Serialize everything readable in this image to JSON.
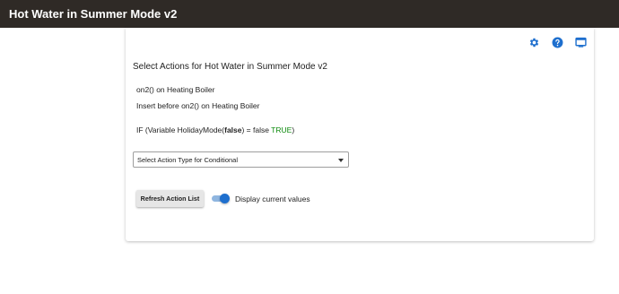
{
  "app": {
    "title": "Hot Water in Summer Mode v2",
    "accent": "#1e6fce",
    "header_bg": "#2f2a26"
  },
  "card": {
    "heading": "Select Actions for Hot Water in Summer Mode v2",
    "actions": {
      "line1": "on2() on Heating Boiler",
      "line2": "Insert before on2() on Heating Boiler",
      "condition": {
        "prefix": "IF (Variable HolidayMode(",
        "value": "false",
        "middle": ") = false ",
        "result": "TRUE",
        "suffix": ")"
      }
    },
    "select": {
      "value": "Select Action Type for Conditional"
    },
    "refresh_button": "Refresh Action List",
    "toggle": {
      "label": "Display current values",
      "on": true
    }
  },
  "icons": [
    "gear-icon",
    "help-icon",
    "monitor-icon"
  ]
}
